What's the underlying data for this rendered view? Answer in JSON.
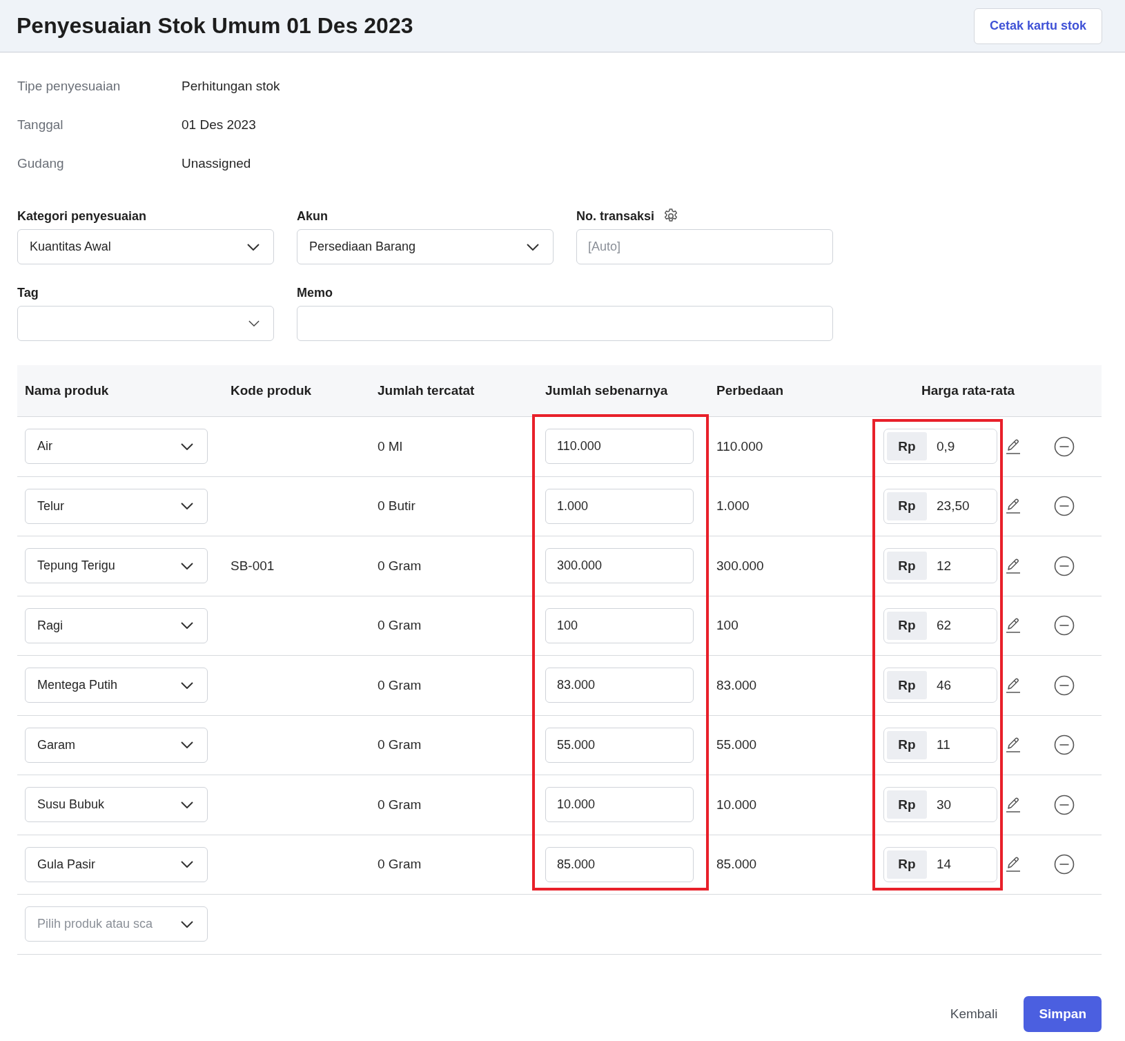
{
  "header": {
    "title": "Penyesuaian Stok Umum 01 Des 2023",
    "print_button": "Cetak kartu stok"
  },
  "details": [
    {
      "label": "Tipe penyesuaian",
      "value": "Perhitungan stok"
    },
    {
      "label": "Tanggal",
      "value": "01 Des 2023"
    },
    {
      "label": "Gudang",
      "value": "Unassigned"
    }
  ],
  "form": {
    "kategori": {
      "label": "Kategori penyesuaian",
      "value": "Kuantitas Awal"
    },
    "akun": {
      "label": "Akun",
      "value": "Persediaan Barang"
    },
    "no_transaksi": {
      "label": "No. transaksi",
      "placeholder": "[Auto]"
    },
    "tag": {
      "label": "Tag"
    },
    "memo": {
      "label": "Memo"
    }
  },
  "table": {
    "columns": [
      {
        "label": "Nama produk",
        "highlighted": false
      },
      {
        "label": "Kode produk",
        "highlighted": false
      },
      {
        "label": "Jumlah tercatat",
        "highlighted": false
      },
      {
        "label": "Jumlah sebenarnya",
        "highlighted": true
      },
      {
        "label": "Perbedaan",
        "highlighted": false
      },
      {
        "label": "Harga rata-rata",
        "highlighted": true
      }
    ],
    "rows": [
      {
        "product": "Air",
        "code": "",
        "recorded": "0 Ml",
        "actual": "110.000",
        "difference": "110.000",
        "currency": "Rp",
        "price": "0,9"
      },
      {
        "product": "Telur",
        "code": "",
        "recorded": "0 Butir",
        "actual": "1.000",
        "difference": "1.000",
        "currency": "Rp",
        "price": "23,50"
      },
      {
        "product": "Tepung Terigu",
        "code": "SB-001",
        "recorded": "0 Gram",
        "actual": "300.000",
        "difference": "300.000",
        "currency": "Rp",
        "price": "12"
      },
      {
        "product": "Ragi",
        "code": "",
        "recorded": "0 Gram",
        "actual": "100",
        "difference": "100",
        "currency": "Rp",
        "price": "62"
      },
      {
        "product": "Mentega Putih",
        "code": "",
        "recorded": "0 Gram",
        "actual": "83.000",
        "difference": "83.000",
        "currency": "Rp",
        "price": "46"
      },
      {
        "product": "Garam",
        "code": "",
        "recorded": "0 Gram",
        "actual": "55.000",
        "difference": "55.000",
        "currency": "Rp",
        "price": "11"
      },
      {
        "product": "Susu Bubuk",
        "code": "",
        "recorded": "0 Gram",
        "actual": "10.000",
        "difference": "10.000",
        "currency": "Rp",
        "price": "30"
      },
      {
        "product": "Gula Pasir",
        "code": "",
        "recorded": "0 Gram",
        "actual": "85.000",
        "difference": "85.000",
        "currency": "Rp",
        "price": "14"
      }
    ],
    "add_product": {
      "placeholder": "Pilih produk atau sca"
    }
  },
  "footer": {
    "back": "Kembali",
    "save": "Simpan"
  }
}
